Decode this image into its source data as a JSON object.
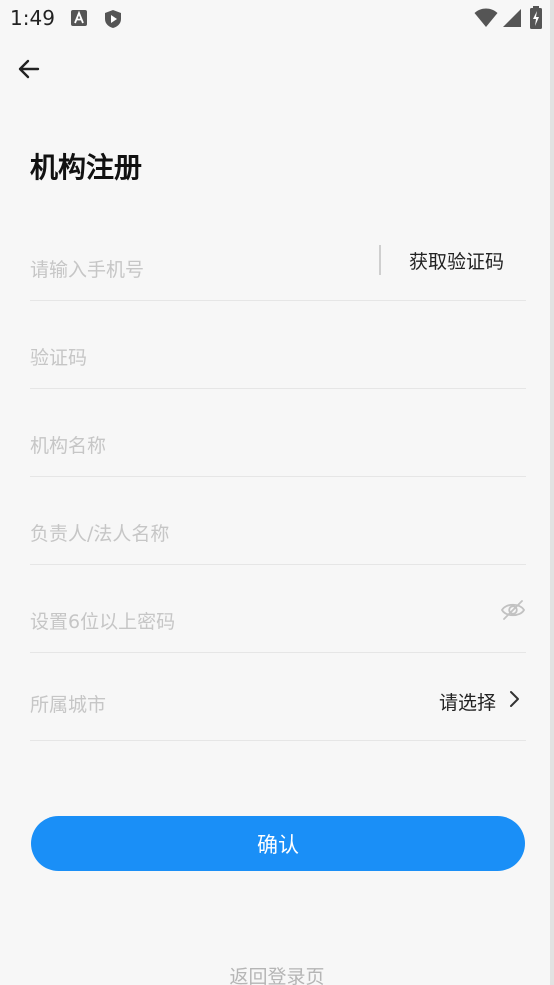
{
  "status_bar": {
    "time": "1:49",
    "icons": [
      "a-notification-icon",
      "shield-play-icon",
      "wifi-icon",
      "cellular-signal-icon",
      "battery-charging-icon"
    ]
  },
  "header": {
    "back_icon": "arrow-left-icon",
    "title": "机构注册"
  },
  "form": {
    "phone": {
      "placeholder": "请输入手机号",
      "get_code_label": "获取验证码"
    },
    "verify_code": {
      "placeholder": "验证码"
    },
    "org_name": {
      "placeholder": "机构名称"
    },
    "legal_person": {
      "placeholder": "负责人/法人名称"
    },
    "password": {
      "placeholder": "设置6位以上密码",
      "toggle_icon": "eye-off-icon"
    },
    "city": {
      "label": "所属城市",
      "select_text": "请选择",
      "chevron_icon": "chevron-right-icon"
    }
  },
  "actions": {
    "confirm_label": "确认",
    "back_to_login_label": "返回登录页"
  },
  "colors": {
    "primary": "#1a8ff7",
    "background": "#f7f7f7",
    "placeholder": "#c6c6c6"
  }
}
